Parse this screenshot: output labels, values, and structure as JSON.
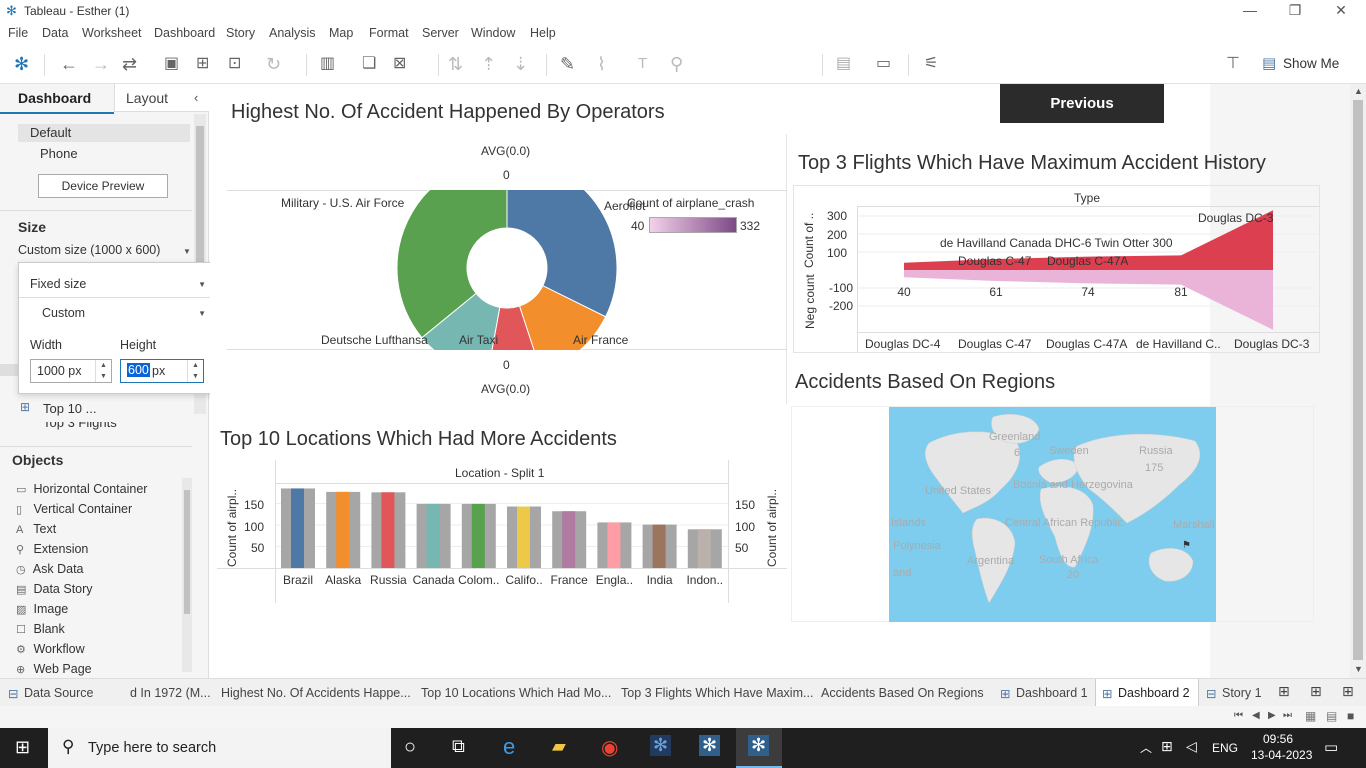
{
  "window": {
    "title": "Tableau - Esther (1)"
  },
  "menu": [
    "File",
    "Data",
    "Worksheet",
    "Dashboard",
    "Story",
    "Analysis",
    "Map",
    "Format",
    "Server",
    "Window",
    "Help"
  ],
  "toolbar": {
    "show_me": "Show Me"
  },
  "left_pane": {
    "tab_dashboard": "Dashboard",
    "tab_layout": "Layout",
    "device_default": "Default",
    "device_phone": "Phone",
    "device_preview": "Device Preview",
    "size_heading": "Size",
    "size_value": "Custom size (1000 x 600)",
    "popup": {
      "mode": "Fixed size",
      "preset": "Custom",
      "width_label": "Width",
      "height_label": "Height",
      "width_value": "1000 px",
      "height_value": "600",
      "height_unit": "px"
    },
    "sheet_items": [
      "Top 10 ...",
      "Top 3 Flights"
    ],
    "objects_heading": "Objects",
    "objects": [
      "Horizontal Container",
      "Vertical Container",
      "Text",
      "Extension",
      "Ask Data",
      "Data Story",
      "Image",
      "Blank",
      "Workflow",
      "Web Page"
    ]
  },
  "dashboard": {
    "previous_button": "Previous",
    "pie": {
      "title": "Highest No. Of Accident Happened By Operators",
      "top_label": "AVG(0.0)",
      "top_zero": "0",
      "bottom_zero": "0",
      "bottom_label": "AVG(0.0)",
      "legend_title": "Count of airplane_crash",
      "legend_min": "40",
      "legend_max": "332",
      "slice_labels": [
        "Military - U.S. Air Force",
        "Aeroflot",
        "Deutsche Lufthansa",
        "Air Taxi",
        "Air France"
      ]
    },
    "area": {
      "title": "Top 3 Flights Which Have Maximum Accident History",
      "header": "Type",
      "y_label_top": "Count of ..",
      "y_label_bottom": "Neg count",
      "top_ticks": [
        "300",
        "200",
        "100"
      ],
      "bottom_ticks": [
        "-100",
        "-200"
      ],
      "labels": [
        "Douglas DC-3",
        "de Havilland Canada DHC-6 Twin Otter 300",
        "Douglas C-47",
        "Douglas C-47A"
      ],
      "x_ticks": [
        "Douglas DC-4",
        "Douglas C-47",
        "Douglas C-47A",
        "de Havilland C..",
        "Douglas DC-3"
      ]
    },
    "map": {
      "title": "Accidents Based On Regions",
      "labels": [
        "Greenland",
        "Russia",
        "175",
        "Sweden",
        "United States",
        "Bosnia and Herzegovina",
        "Central African Republic",
        "Marshall",
        "Islands",
        "Polynesia",
        "South Africa",
        "Argentina",
        "and",
        "20",
        "6"
      ]
    },
    "bar": {
      "title": "Top 10 Locations Which Had More Accidents",
      "header": "Location - Split 1",
      "y_label": "Count of airpl..",
      "ticks": [
        "150",
        "100",
        "50"
      ]
    }
  },
  "chart_data": [
    {
      "type": "pie",
      "title": "Highest No. Of Accident Happened By Operators",
      "categories": [
        "Aeroflot",
        "Air France",
        "Air Taxi",
        "Deutsche Lufthansa",
        "Military - U.S. Air Force"
      ],
      "values": [
        179,
        70,
        44,
        62,
        199
      ],
      "colors": [
        "#4e79a7",
        "#f28e2b",
        "#e15759",
        "#76b7b2",
        "#59a14f"
      ]
    },
    {
      "type": "area",
      "title": "Top 3 Flights Which Have Maximum Accident History",
      "categories": [
        "Douglas DC-4",
        "Douglas C-47",
        "Douglas C-47A",
        "de Havilland C..",
        "Douglas DC-3"
      ],
      "series": [
        {
          "name": "Count of ..",
          "values": [
            40,
            61,
            74,
            81,
            332
          ]
        },
        {
          "name": "Neg count",
          "values": [
            -40,
            -61,
            -74,
            -81,
            -332
          ]
        }
      ],
      "ylim": [
        -300,
        300
      ]
    },
    {
      "type": "bar",
      "title": "Top 10 Locations Which Had More Accidents",
      "categories": [
        "Brazil",
        "Alaska",
        "Russia",
        "Canada",
        "Colom..",
        "Califo..",
        "France",
        "Engla..",
        "India",
        "Indon.."
      ],
      "values": [
        185,
        177,
        176,
        149,
        149,
        143,
        132,
        106,
        101,
        90
      ],
      "colors": [
        "#4e79a7",
        "#f28e2b",
        "#e15759",
        "#76b7b2",
        "#59a14f",
        "#edc948",
        "#b07aa1",
        "#ff9da7",
        "#9c755f",
        "#bab0ac"
      ],
      "ylim": [
        0,
        200
      ]
    }
  ],
  "bottom_tabs": [
    "Data Source",
    "d In 1972 (M...",
    "Highest No. Of Accidents Happe...",
    "Top 10 Locations Which Had Mo...",
    "Top 3 Flights Which Have Maxim...",
    "Accidents Based On Regions",
    "Dashboard 1",
    "Dashboard 2",
    "Story 1"
  ],
  "taskbar": {
    "search_placeholder": "Type here to search",
    "lang": "ENG",
    "time": "09:56",
    "date": "13-04-2023"
  }
}
